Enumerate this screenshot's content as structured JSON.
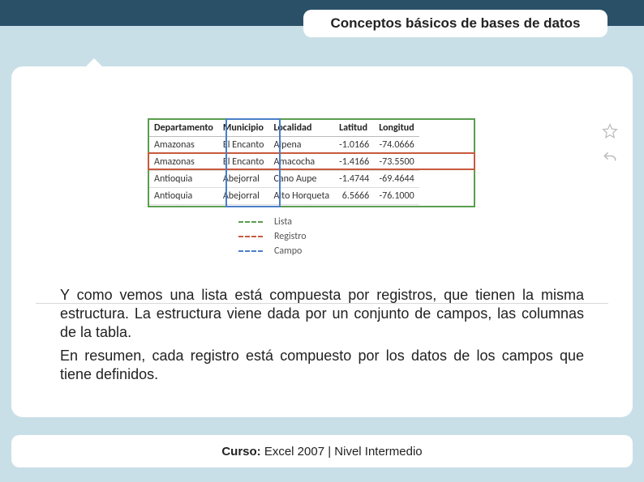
{
  "title": "Conceptos básicos de bases de datos",
  "table": {
    "headers": [
      "Departamento",
      "Municipio",
      "Localidad",
      "Latitud",
      "Longitud"
    ],
    "rows": [
      [
        "Amazonas",
        "El Encanto",
        "Alpena",
        "-1.0166",
        "-74.0666"
      ],
      [
        "Amazonas",
        "El Encanto",
        "Amacocha",
        "-1.4166",
        "-73.5500"
      ],
      [
        "Antioquia",
        "Abejorral",
        "Cano Aupe",
        "-1.4744",
        "-69.4644"
      ],
      [
        "Antioquia",
        "Abejorral",
        "Alto Horqueta",
        "6.5666",
        "-76.1000"
      ]
    ]
  },
  "legend": {
    "lista": "Lista",
    "registro": "Registro",
    "campo": "Campo"
  },
  "paragraphs": {
    "p1": "Y como vemos una lista está compuesta por registros, que tienen la misma estructura. La estructura viene dada por un conjunto de campos, las columnas de la tabla.",
    "p2": "En resumen, cada registro está compuesto por los datos de los campos que tiene definidos."
  },
  "footer": {
    "label": "Curso: ",
    "value": "Excel 2007 | Nivel Intermedio"
  }
}
